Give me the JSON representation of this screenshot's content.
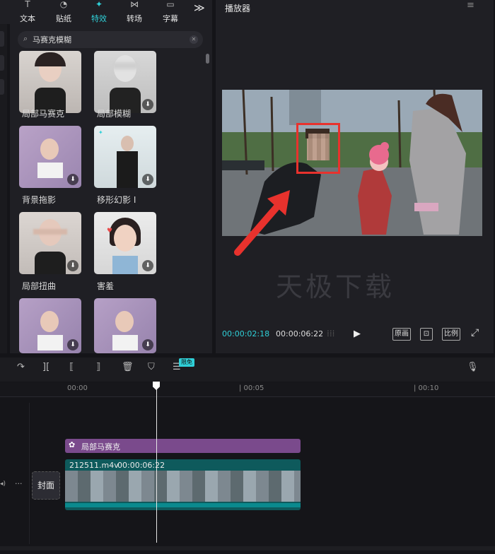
{
  "top_tabs": [
    {
      "label": "文本",
      "icon": "text-icon"
    },
    {
      "label": "贴纸",
      "icon": "sticker-icon"
    },
    {
      "label": "特效",
      "icon": "effects-icon"
    },
    {
      "label": "转场",
      "icon": "transition-icon"
    },
    {
      "label": "字幕",
      "icon": "subtitle-icon"
    }
  ],
  "active_tab": "特效",
  "more": "≫",
  "search": {
    "value": "马赛克模糊"
  },
  "effects": [
    {
      "label": "局部马赛克",
      "download": false
    },
    {
      "label": "局部模糊",
      "download": true
    },
    {
      "label": "背景拖影",
      "download": true
    },
    {
      "label": "移形幻影 I",
      "download": true
    },
    {
      "label": "局部扭曲",
      "download": true
    },
    {
      "label": "害羞",
      "download": true
    },
    {
      "label": "",
      "download": true
    },
    {
      "label": "",
      "download": true
    }
  ],
  "player": {
    "title": "播放器",
    "watermark": "天极下载",
    "current_time": "00:00:02:18",
    "total_time": "00:00:06:22",
    "btn_original": "原画",
    "btn_ratio": "比例"
  },
  "toolbar": {
    "badge": "限免"
  },
  "ruler": [
    "00:00",
    "| 00:05",
    "| 00:10"
  ],
  "timeline": {
    "effect_clip": "局部马赛克",
    "video_clip_name": "212511.m4v",
    "video_clip_duration": "00:00:06:22",
    "cover_label": "封面"
  },
  "colors": {
    "accent": "#2fd0d8",
    "effect_clip": "#7a4a8c",
    "video_clip": "#0e5a5c",
    "highlight_box": "#e8322d"
  }
}
